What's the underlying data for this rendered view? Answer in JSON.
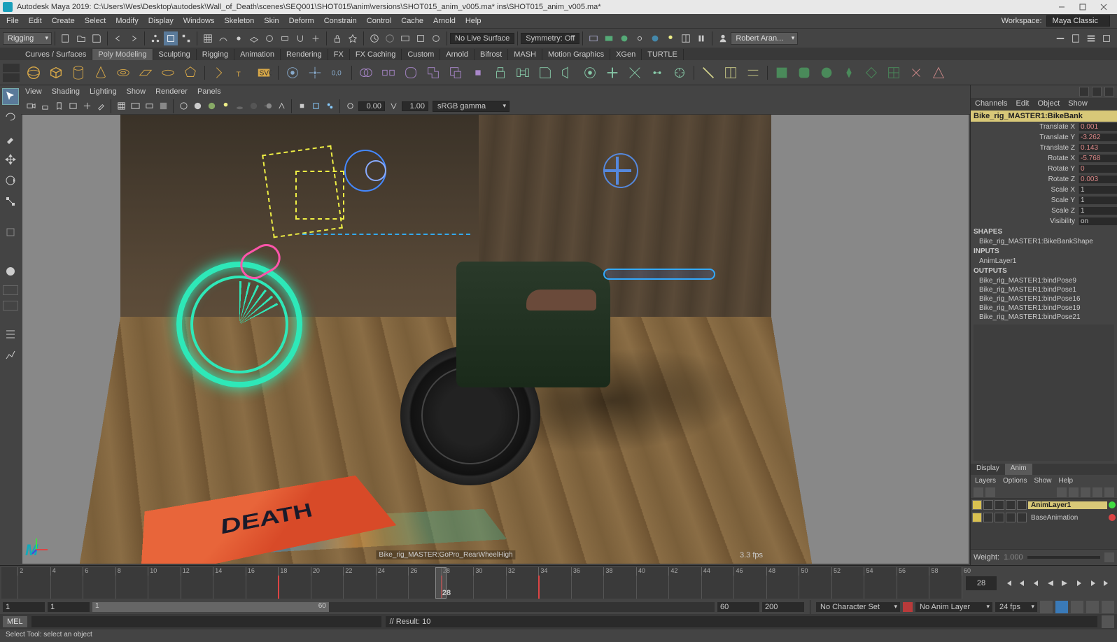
{
  "title": "Autodesk Maya 2019: C:\\Users\\Wes\\Desktop\\autodesk\\Wall_of_Death\\scenes\\SEQ001\\SHOT015\\anim\\versions\\SHOT015_anim_v005.ma*  ins\\SHOT015_anim_v005.ma*",
  "menus": [
    "File",
    "Edit",
    "Create",
    "Select",
    "Modify",
    "Display",
    "Windows",
    "Skeleton",
    "Skin",
    "Deform",
    "Constrain",
    "Control",
    "Cache",
    "Arnold",
    "Help"
  ],
  "workspace_label": "Workspace:",
  "workspace_value": "Maya Classic",
  "module_dd": "Rigging",
  "live_surface": "No Live Surface",
  "symmetry": "Symmetry: Off",
  "user": "Robert Aran...",
  "shelf_tabs": [
    "Curves / Surfaces",
    "Poly Modeling",
    "Sculpting",
    "Rigging",
    "Animation",
    "Rendering",
    "FX",
    "FX Caching",
    "Custom",
    "Arnold",
    "Bifrost",
    "MASH",
    "Motion Graphics",
    "XGen",
    "TURTLE"
  ],
  "shelf_active": "Poly Modeling",
  "vp_menus": [
    "View",
    "Shading",
    "Lighting",
    "Show",
    "Renderer",
    "Panels"
  ],
  "vp_exposure": "0.00",
  "vp_gamma": "1.00",
  "vp_colorspace": "sRGB gamma",
  "hud_cam": "Bike_rig_MASTER:GoPro_RearWheelHigh",
  "fps": "3.3 fps",
  "channelbox": {
    "tabs": [
      "Channels",
      "Edit",
      "Object",
      "Show"
    ],
    "object": "Bike_rig_MASTER1:BikeBank",
    "attrs": [
      {
        "label": "Translate X",
        "value": "0.001",
        "keyed": true
      },
      {
        "label": "Translate Y",
        "value": "-3.262",
        "keyed": true
      },
      {
        "label": "Translate Z",
        "value": "0.143",
        "keyed": true
      },
      {
        "label": "Rotate X",
        "value": "-5.768",
        "keyed": true
      },
      {
        "label": "Rotate Y",
        "value": "0",
        "keyed": true
      },
      {
        "label": "Rotate Z",
        "value": "0.003",
        "keyed": true
      },
      {
        "label": "Scale X",
        "value": "1",
        "keyed": false
      },
      {
        "label": "Scale Y",
        "value": "1",
        "keyed": false
      },
      {
        "label": "Scale Z",
        "value": "1",
        "keyed": false
      },
      {
        "label": "Visibility",
        "value": "on",
        "keyed": false
      }
    ],
    "shapes_hdr": "SHAPES",
    "shape": "Bike_rig_MASTER1:BikeBankShape",
    "inputs_hdr": "INPUTS",
    "input": "AnimLayer1",
    "outputs_hdr": "OUTPUTS",
    "outputs": [
      "Bike_rig_MASTER1:bindPose9",
      "Bike_rig_MASTER1:bindPose1",
      "Bike_rig_MASTER1:bindPose16",
      "Bike_rig_MASTER1:bindPose19",
      "Bike_rig_MASTER1:bindPose21"
    ]
  },
  "layertabs": [
    "Display",
    "Anim"
  ],
  "layermenu": [
    "Layers",
    "Options",
    "Show",
    "Help"
  ],
  "layers": [
    {
      "name": "AnimLayer1",
      "active": true,
      "status": "green"
    },
    {
      "name": "BaseAnimation",
      "active": false,
      "status": "red"
    }
  ],
  "weight_label": "Weight:",
  "weight_value": "1.000",
  "timeline": {
    "ticks": [
      "2",
      "4",
      "6",
      "8",
      "10",
      "12",
      "14",
      "16",
      "18",
      "20",
      "22",
      "24",
      "26",
      "28",
      "30",
      "32",
      "34",
      "36",
      "38",
      "40",
      "42",
      "44",
      "46",
      "48",
      "50",
      "52",
      "54",
      "56",
      "58",
      "60"
    ],
    "current": "28",
    "current_display": "28",
    "range_start": "1",
    "range_end": "60",
    "anim_start": "1",
    "anim_end": "60",
    "scene_end": "200"
  },
  "charset": "No Character Set",
  "animlayer_dd": "No Anim Layer",
  "fps_dd": "24 fps",
  "cmd_label": "MEL",
  "cmd_result": "// Result: 10",
  "helpline": "Select Tool: select an object",
  "banner_text": "DEATH"
}
